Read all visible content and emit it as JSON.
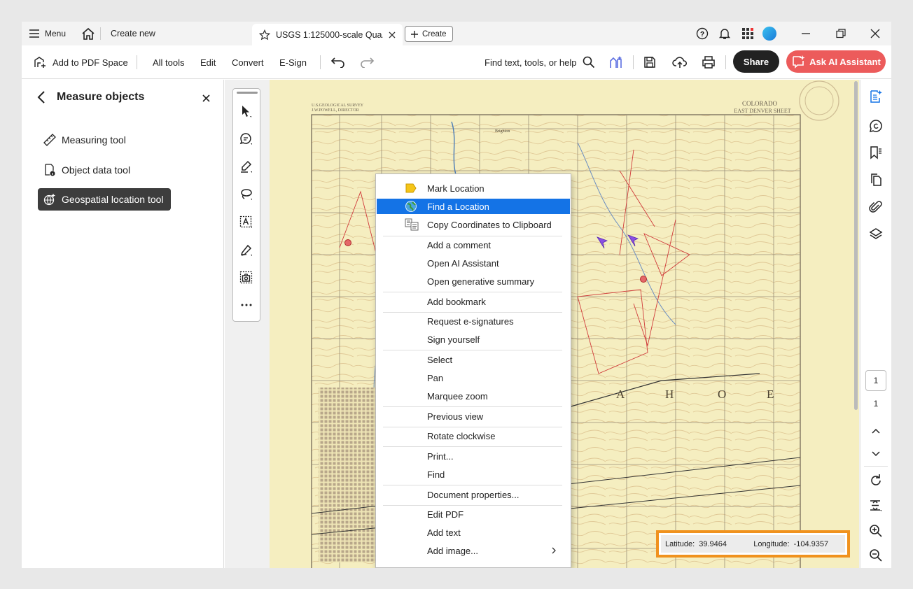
{
  "titlebar": {
    "menu_label": "Menu",
    "create_new_label": "Create new",
    "tab_title": "USGS 1:125000-scale Qua...",
    "create_button_label": "Create"
  },
  "toolbar": {
    "add_to_pdf_space": "Add to PDF Space",
    "all_tools": "All tools",
    "edit": "Edit",
    "convert": "Convert",
    "esign": "E-Sign",
    "search_label": "Find text, tools, or help",
    "share": "Share",
    "ask_ai": "Ask AI Assistant"
  },
  "left_panel": {
    "title": "Measure objects",
    "items": [
      {
        "label": "Measuring tool",
        "icon": "ruler-icon"
      },
      {
        "label": "Object data tool",
        "icon": "object-data-icon"
      },
      {
        "label": "Geospatial location tool",
        "icon": "geospatial-icon",
        "selected": true
      }
    ]
  },
  "map": {
    "header_left_1": "U.S.GEOLOGICAL SURVEY",
    "header_left_2": "J.W.POWELL, DIRECTOR",
    "header_right_1": "COLORADO",
    "header_right_2": "EAST DENVER SHEET",
    "big_letters": [
      "A",
      "H",
      "O",
      "E"
    ],
    "town_label": "Brighton"
  },
  "context_menu": {
    "items": [
      {
        "label": "Mark Location",
        "icon": "mark-location-icon"
      },
      {
        "label": "Find a Location",
        "icon": "globe-icon",
        "highlighted": true
      },
      {
        "label": "Copy Coordinates to Clipboard",
        "icon": "copy-coordinates-icon"
      },
      {
        "label": "Add a comment"
      },
      {
        "label": "Open AI Assistant"
      },
      {
        "label": "Open generative summary"
      },
      {
        "label": "Add bookmark"
      },
      {
        "label": "Request e-signatures"
      },
      {
        "label": "Sign yourself"
      },
      {
        "label": "Select"
      },
      {
        "label": "Pan"
      },
      {
        "label": "Marquee zoom"
      },
      {
        "label": "Previous view"
      },
      {
        "label": "Rotate clockwise"
      },
      {
        "label": "Print..."
      },
      {
        "label": "Find"
      },
      {
        "label": "Document properties..."
      },
      {
        "label": "Edit PDF"
      },
      {
        "label": "Add text"
      },
      {
        "label": "Add image...",
        "submenu": true
      }
    ]
  },
  "geo_readout": {
    "latitude_label": "Latitude:",
    "latitude_value": "39.9464",
    "longitude_label": "Longitude:",
    "longitude_value": "-104.9357"
  },
  "page_nav": {
    "current_page": "1",
    "total_pages": "1"
  },
  "colors": {
    "accent": "#1473e6",
    "ai_button": "#ec5b5b",
    "highlight_box": "#f0921e",
    "map_paper": "#f5eec0"
  }
}
